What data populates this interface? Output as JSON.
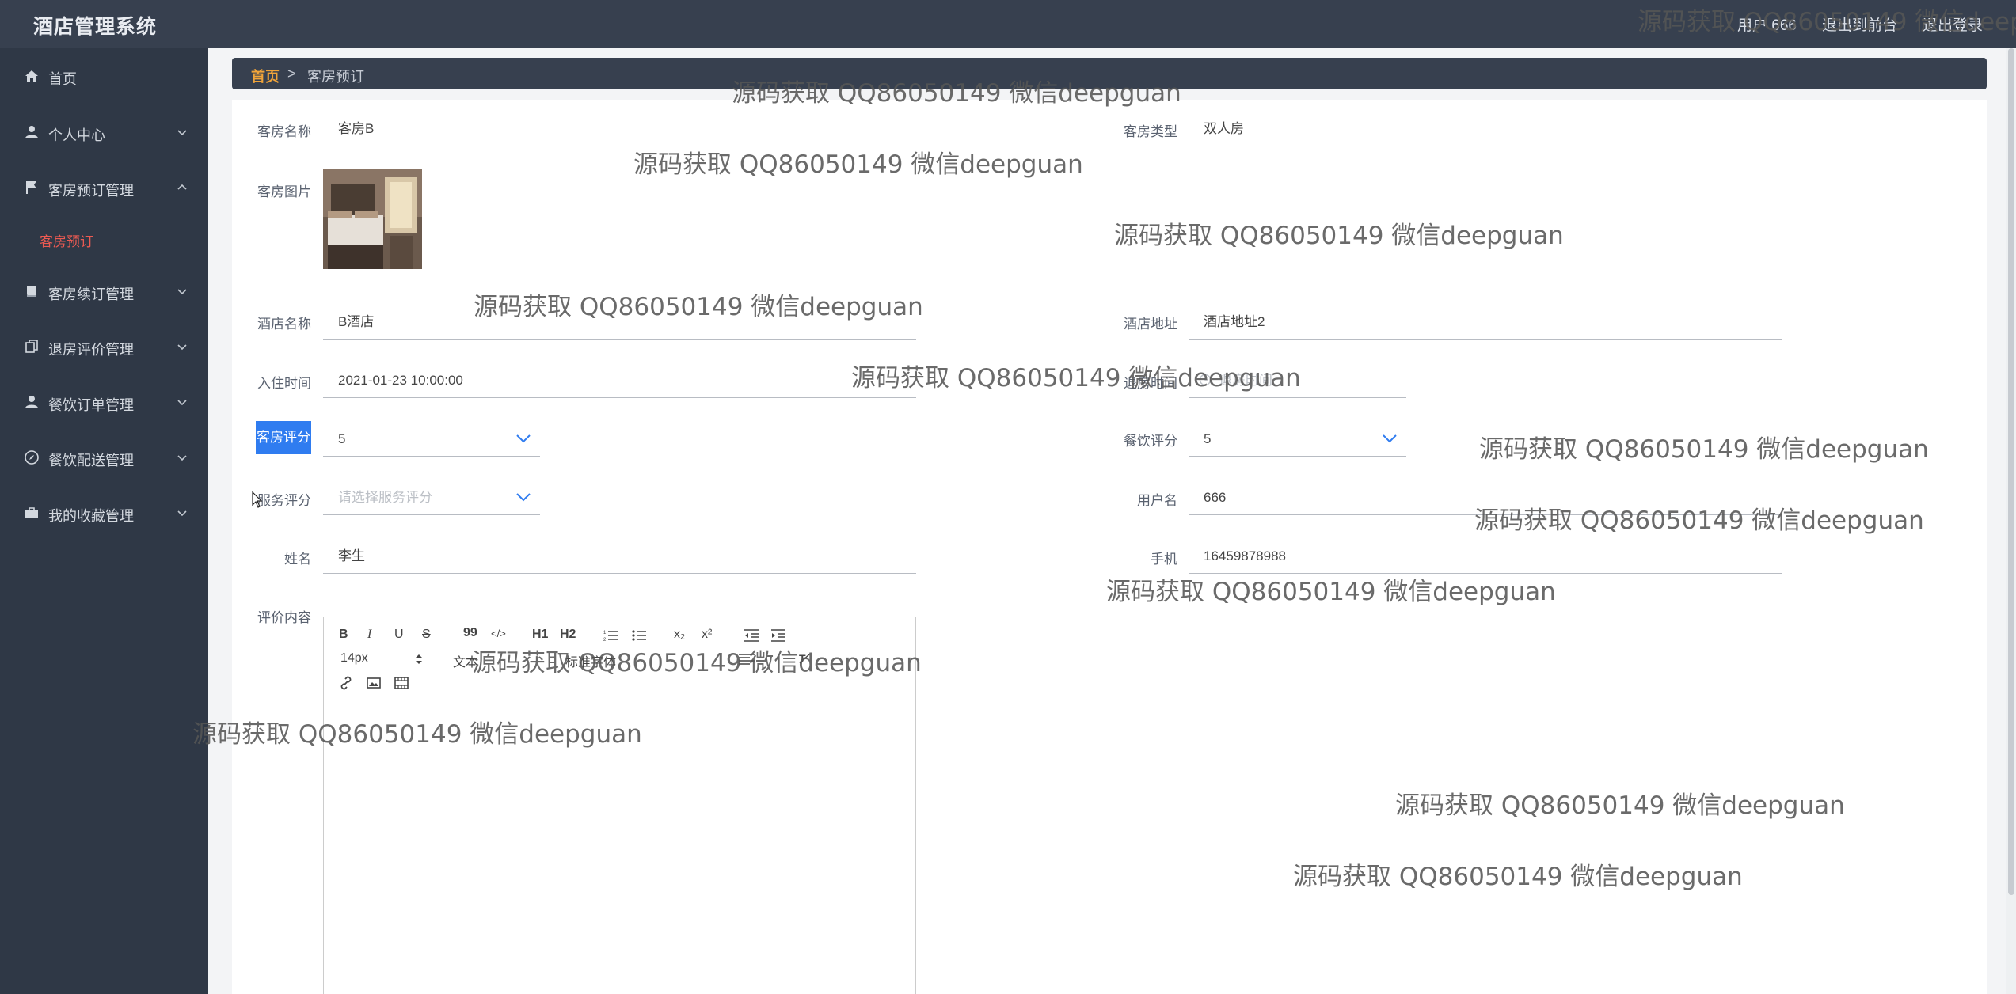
{
  "header": {
    "brand": "酒店管理系统",
    "user": "用户 666",
    "back_front": "退出到前台",
    "logout": "退出登录"
  },
  "sidebar": {
    "items": [
      {
        "label": "首页",
        "icon": "home-icon"
      },
      {
        "label": "个人中心",
        "icon": "user-icon"
      },
      {
        "label": "客房预订管理",
        "icon": "flag-icon",
        "expanded": true
      },
      {
        "label": "客房续订管理",
        "icon": "book-icon"
      },
      {
        "label": "退房评价管理",
        "icon": "copy-icon"
      },
      {
        "label": "餐饮订单管理",
        "icon": "user-icon"
      },
      {
        "label": "餐饮配送管理",
        "icon": "compass-icon"
      },
      {
        "label": "我的收藏管理",
        "icon": "briefcase-icon"
      }
    ],
    "active_sub": "客房预订"
  },
  "breadcrumb": {
    "home": "首页",
    "sep": ">",
    "current": "客房预订"
  },
  "form": {
    "room_name_label": "客房名称",
    "room_name": "客房B",
    "room_type_label": "客房类型",
    "room_type": "双人房",
    "room_image_label": "客房图片",
    "hotel_name_label": "酒店名称",
    "hotel_name": "B酒店",
    "hotel_address_label": "酒店地址",
    "hotel_address": "酒店地址2",
    "checkin_label": "入住时间",
    "checkin": "2021-01-23 10:00:00",
    "checkout_label": "退房时间",
    "checkout_placeholder": "退房时间",
    "room_rating_label": "客房评分",
    "room_rating": "5",
    "food_rating_label": "餐饮评分",
    "food_rating": "5",
    "service_rating_label": "服务评分",
    "service_rating_placeholder": "请选择服务评分",
    "username_label": "用户名",
    "username": "666",
    "name_label": "姓名",
    "name": "李生",
    "phone_label": "手机",
    "phone": "16459878988",
    "review_label": "评价内容"
  },
  "editor": {
    "font_size": "14px",
    "text_label": "文本",
    "font_label": "标准字体",
    "buttons": [
      "B",
      "I",
      "U",
      "S",
      "99",
      "</>",
      "H1",
      "H2",
      "ol",
      "ul",
      "x₂",
      "x²",
      "outdent",
      "indent"
    ]
  },
  "watermark": "源码获取 QQ86050149 微信deepguan",
  "colors": {
    "header_bg": "#37404f",
    "sidebar_bg": "#2f3846",
    "accent": "#ec5a52",
    "breadcrumb_home": "#f0a43a",
    "highlight": "#2f7cf0"
  }
}
